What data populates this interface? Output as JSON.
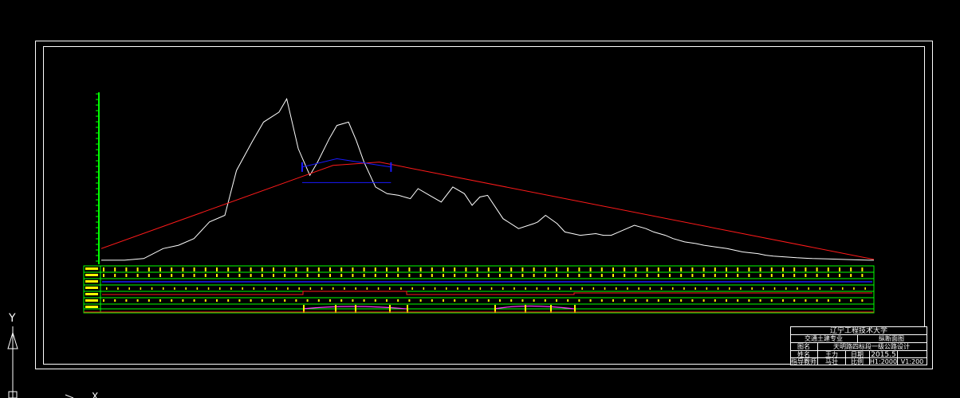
{
  "drawing": {
    "background": "#000000",
    "frame_color": "#ffffff",
    "ground_color": "#ffffff",
    "design_color": "#ff1a1a",
    "curve_color": "#1a1aff",
    "axis_color": "#00ff00",
    "band_color": "#ffff00",
    "ucs": {
      "y_label": "Y",
      "x_label": "X"
    }
  },
  "title_block": {
    "university": "辽宁工程技术大学",
    "major": "交通土建专业",
    "sheet_name": "纵断面图",
    "project": "天明路四标段一级公路设计",
    "label_drawing": "图名",
    "label_name": "姓名",
    "name": "王力",
    "label_date": "日期",
    "date": "2015.5",
    "label_teacher": "指导教师",
    "teacher": "马壮",
    "label_scale": "比例",
    "scale": "H1:2000",
    "scale_v": "V1:200"
  },
  "chart_data": {
    "type": "line",
    "x_range": [
      0,
      1000
    ],
    "y_range": [
      0,
      100
    ],
    "series": [
      {
        "role": "ground",
        "x": [
          0,
          30,
          55,
          80,
          100,
          120,
          140,
          160,
          175,
          195,
          210,
          230,
          240,
          255,
          270,
          280,
          295,
          305,
          320,
          330,
          340,
          355,
          370,
          385,
          400,
          410,
          425,
          440,
          455,
          470,
          480,
          490,
          500,
          520,
          540,
          560,
          565,
          575,
          590,
          600,
          620,
          640,
          650,
          660,
          670,
          690,
          705,
          715,
          730,
          740,
          755,
          770,
          780,
          795,
          810,
          830,
          850,
          860,
          870,
          885,
          900,
          920,
          940,
          960,
          980,
          995,
          1000
        ],
        "y": [
          1,
          1,
          2,
          8,
          10,
          14,
          24,
          28,
          55,
          72,
          84,
          90,
          98,
          68,
          52,
          60,
          74,
          82,
          84,
          73,
          60,
          45,
          41,
          40,
          38,
          44,
          40,
          36,
          45,
          41,
          34,
          39,
          40,
          26,
          20,
          23,
          24,
          28,
          23,
          18,
          16,
          17,
          16,
          16,
          18,
          22,
          20,
          18,
          16,
          14,
          12,
          11,
          10,
          9,
          8,
          6,
          5,
          4,
          3.5,
          3,
          2.5,
          2,
          1.8,
          1.5,
          1.2,
          1.0,
          1.0
        ]
      },
      {
        "role": "design",
        "x": [
          0,
          300,
          360,
          1000
        ],
        "y": [
          8,
          58,
          60,
          1.5
        ]
      },
      {
        "role": "vertical-curve",
        "x": [
          260,
          305,
          375
        ],
        "y": [
          57,
          62,
          57
        ]
      }
    ]
  }
}
